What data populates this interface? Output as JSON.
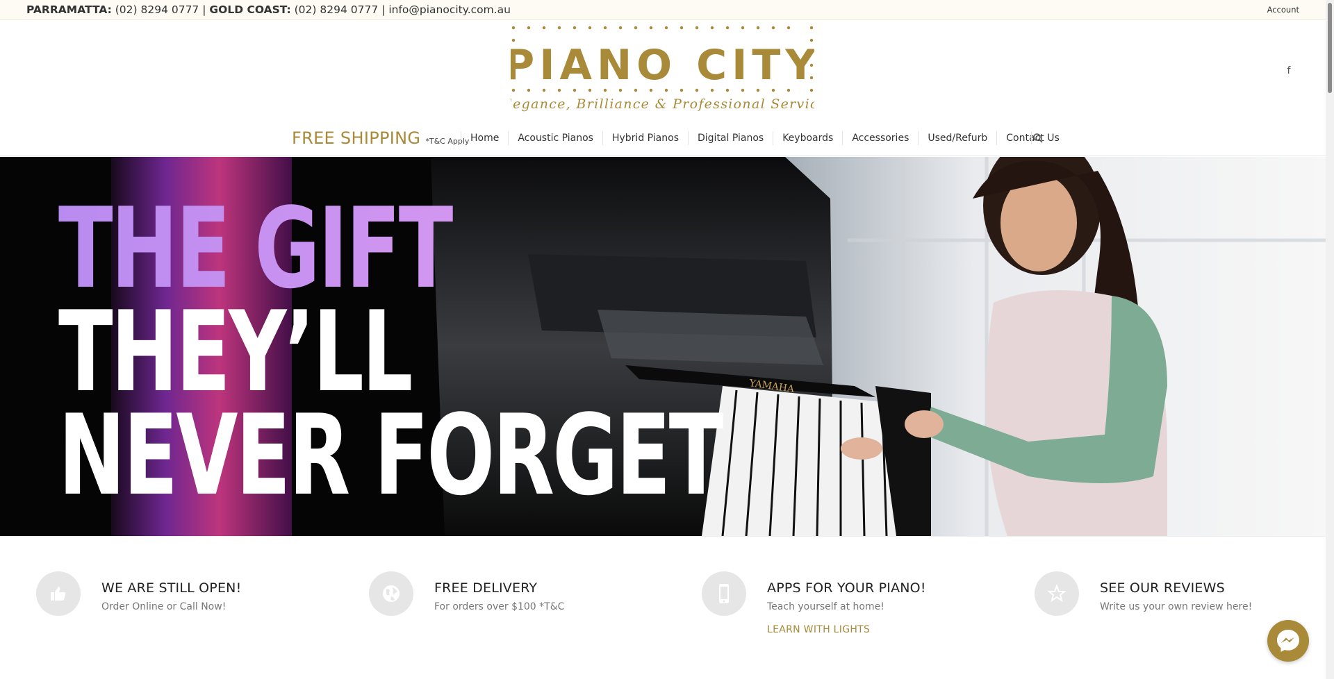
{
  "topbar": {
    "loc1_label": "PARRAMATTA:",
    "loc1_phone": "(02) 8294 0777",
    "sep1": "|",
    "loc2_label": "GOLD COAST:",
    "loc2_phone": "(02) 8294 0777",
    "sep2": "|",
    "email": "info@pianocity.com.au",
    "account": "Account"
  },
  "logo": {
    "name": "PIANO CITY",
    "tagline": "Elegance, Brilliance & Professional Service"
  },
  "social": {
    "facebook": "f"
  },
  "nav": {
    "shipping_big": "FREE SHIPPING",
    "shipping_small": "*T&C Apply",
    "items": [
      "Home",
      "Acoustic Pianos",
      "Hybrid Pianos",
      "Digital Pianos",
      "Keyboards",
      "Accessories",
      "Used/Refurb",
      "Contact Us"
    ]
  },
  "hero": {
    "line1": "THE GIFT",
    "line2": "THEY’LL",
    "line3": "NEVER FORGET",
    "brand_on_piano": "YAMAHA"
  },
  "features": [
    {
      "icon": "thumbs-up-icon",
      "title": "WE ARE STILL OPEN!",
      "subtitle": "Order Online or Call Now!"
    },
    {
      "icon": "globe-icon",
      "title": "FREE DELIVERY",
      "subtitle": "For orders over $100 *T&C"
    },
    {
      "icon": "phone-icon",
      "title": "APPS FOR YOUR PIANO!",
      "subtitle": "Teach yourself at home!",
      "link": "LEARN WITH LIGHTS"
    },
    {
      "icon": "star-icon",
      "title": "SEE OUR REVIEWS",
      "subtitle": "Write us your own review here!"
    }
  ],
  "colors": {
    "gold": "#a88a39",
    "topbar_bg": "#fdfbf3",
    "icon_circle": "#e6e6e6"
  }
}
